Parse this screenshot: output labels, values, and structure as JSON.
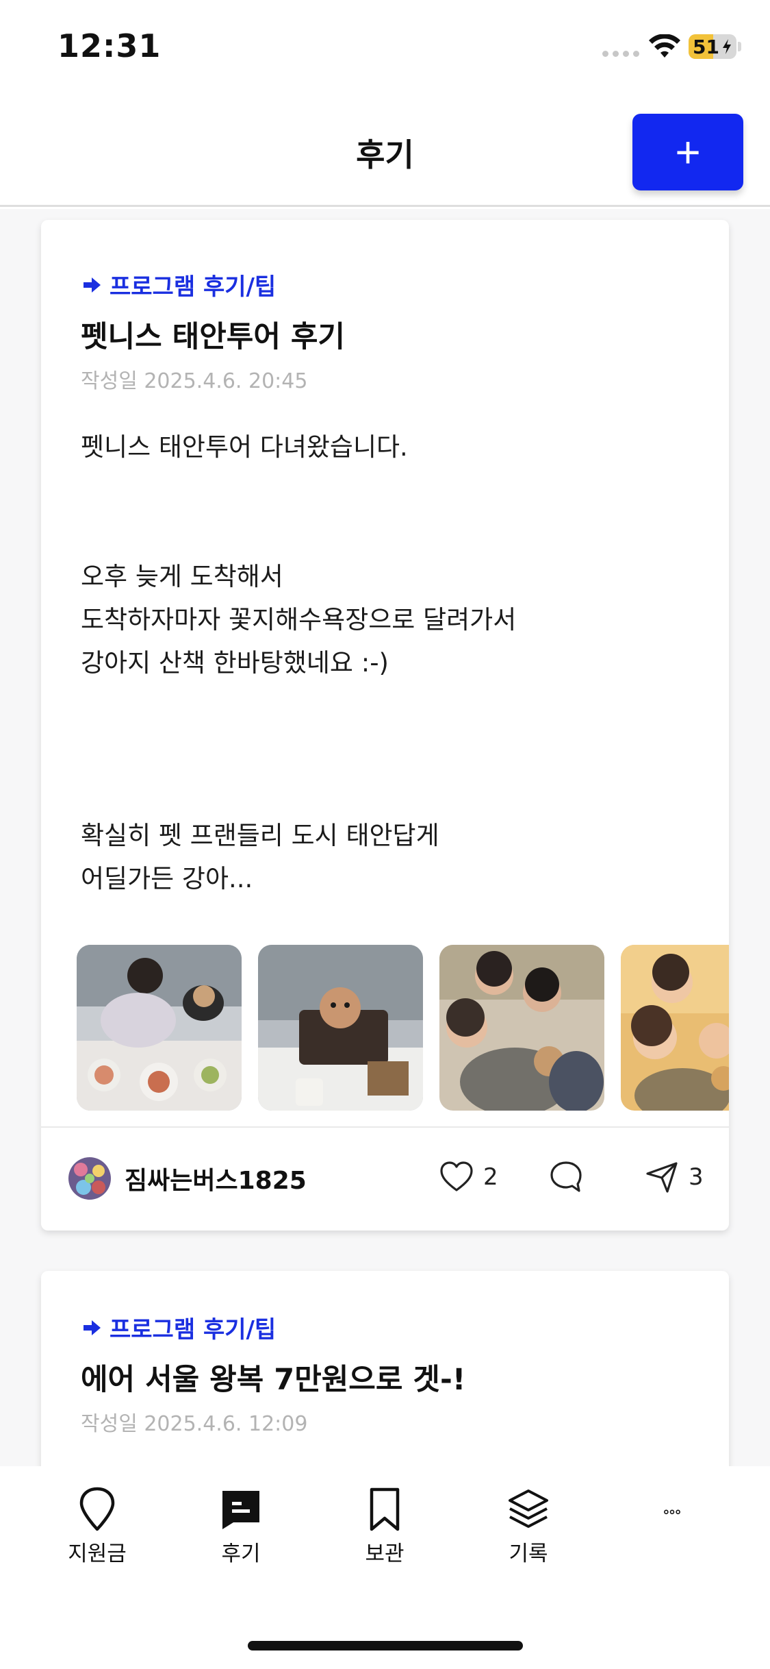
{
  "status_bar": {
    "time": "12:31",
    "battery": "51",
    "battery_level": 0.51
  },
  "header": {
    "title": "후기",
    "add_label": "+"
  },
  "posts": [
    {
      "category": "프로그램 후기/팁",
      "title": "펫니스 태안투어 후기",
      "date": "작성일 2025.4.6. 20:45",
      "body": "펫니스 태안투어 다녀왔습니다.\n\n\n오후 늦게 도착해서\n도착하자마자 꽃지해수욕장으로 달려가서\n강아지 산책 한바탕했네요 :-)\n\n\n\n확실히 펫 프랜들리 도시 태안답게\n어딜가든 강아...",
      "author": "짐싸는버스1825",
      "likes": "2",
      "shares": "3"
    },
    {
      "category": "프로그램 후기/팁",
      "title": "에어 서울 왕복 7만원으로 겟-!",
      "date": "작성일 2025.4.6. 12:09"
    }
  ],
  "tabs": [
    {
      "label": "지원금",
      "icon": "location-pin-icon"
    },
    {
      "label": "후기",
      "icon": "chat-bubble-icon"
    },
    {
      "label": "보관",
      "icon": "bookmark-icon"
    },
    {
      "label": "기록",
      "icon": "layers-icon"
    },
    {
      "label": "",
      "icon": "more-icon"
    }
  ],
  "colors": {
    "accent": "#1228f0",
    "category": "#1a2fe0"
  }
}
